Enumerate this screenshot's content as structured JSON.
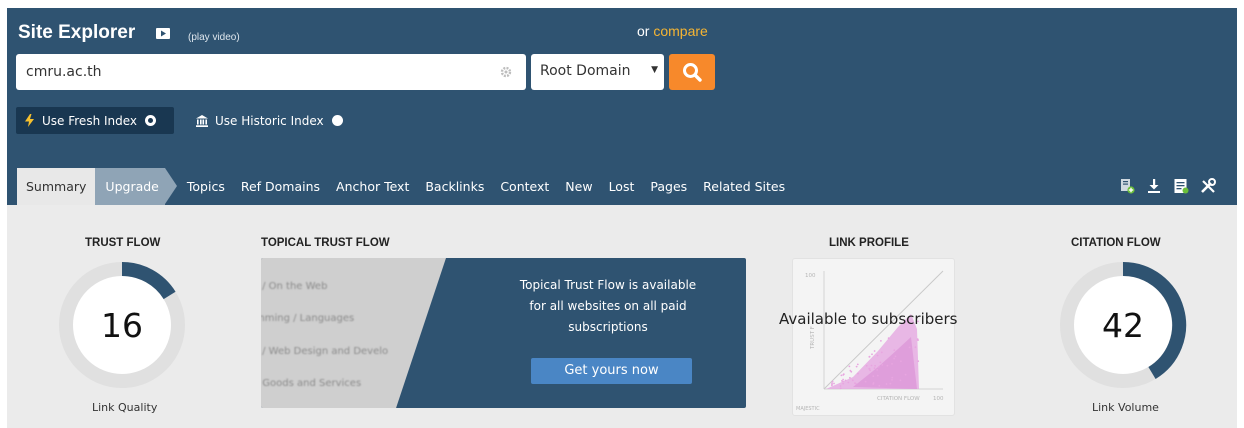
{
  "header": {
    "title": "Site Explorer",
    "video_label": "(play video)",
    "compare_prefix": "or",
    "compare_link": "compare"
  },
  "search": {
    "value": "cmru.ac.th",
    "scope": "Root Domain"
  },
  "index": {
    "fresh_label": "Use Fresh Index",
    "historic_label": "Use Historic Index",
    "selected": "fresh"
  },
  "tabs": [
    {
      "label": "Summary"
    },
    {
      "label": "Upgrade"
    },
    {
      "label": "Topics"
    },
    {
      "label": "Ref Domains"
    },
    {
      "label": "Anchor Text"
    },
    {
      "label": "Backlinks"
    },
    {
      "label": "Context"
    },
    {
      "label": "New"
    },
    {
      "label": "Lost"
    },
    {
      "label": "Pages"
    },
    {
      "label": "Related Sites"
    }
  ],
  "tool_icons": [
    "add-report-icon",
    "download-icon",
    "report-icon",
    "tools-icon"
  ],
  "trust_flow": {
    "title": "TRUST FLOW",
    "value": "16",
    "caption": "Link Quality"
  },
  "topical": {
    "title": "TOPICAL TRUST FLOW",
    "blurred_topics": [
      "t / On the Web",
      "mming / Languages",
      "t / Web Design and Develo",
      "r Goods and Services"
    ],
    "message": "Topical Trust Flow is available for all websites on all paid subscriptions",
    "button": "Get yours now"
  },
  "link_profile": {
    "title": "LINK PROFILE",
    "overlay": "Available to subscribers",
    "axis_y": "TRUST F",
    "axis_x": "CITATION FLOW",
    "tick_max": "100",
    "brand": "MAJESTIC"
  },
  "citation_flow": {
    "title": "CITATION FLOW",
    "value": "42",
    "caption": "Link Volume"
  },
  "colors": {
    "header_bg": "#2f5371",
    "accent_orange": "#f7892b",
    "link_yellow": "#f6b533",
    "gauge_fill": "#2f5371",
    "button_blue": "#4a86c5"
  }
}
